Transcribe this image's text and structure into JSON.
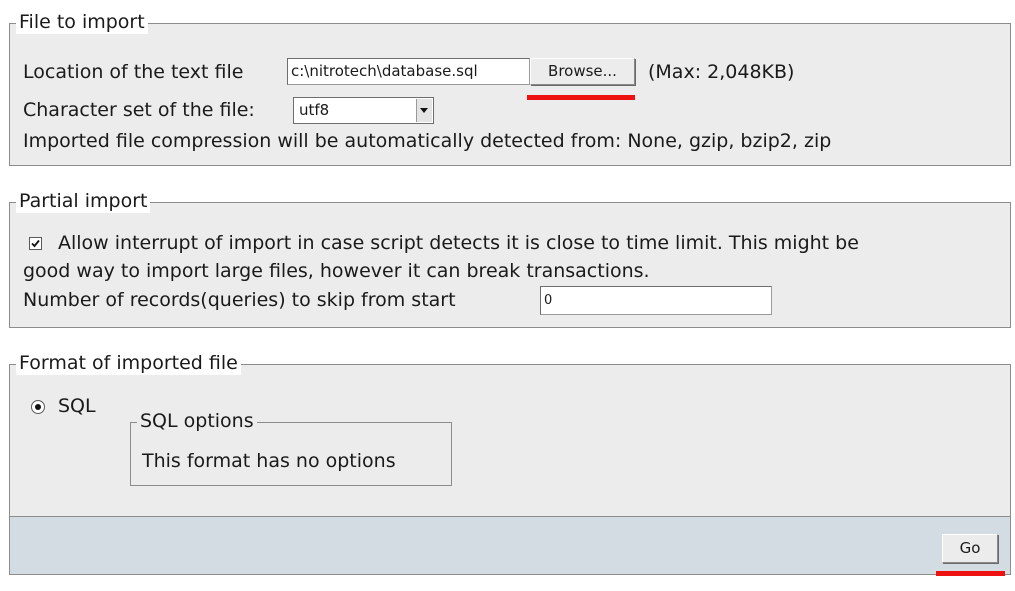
{
  "file_to_import": {
    "legend": "File to import",
    "location_label": "Location of the text file",
    "location_value": "c:\\nitrotech\\database.sql",
    "browse_label": "Browse...",
    "max_size": "(Max: 2,048KB)",
    "charset_label": "Character set of the file:",
    "charset_value": "utf8",
    "compression_note": "Imported file compression will be automatically detected from: None, gzip, bzip2, zip"
  },
  "partial_import": {
    "legend": "Partial import",
    "allow_interrupt_checked": true,
    "allow_interrupt_line1": "Allow interrupt of import in case script detects it is close to time limit. This might be",
    "allow_interrupt_line2": "good way to import large files, however it can break transactions.",
    "skip_label": "Number of records(queries) to skip from start",
    "skip_value": "0"
  },
  "format": {
    "legend": "Format of imported file",
    "sql_selected": true,
    "sql_label": "SQL",
    "options_legend": "SQL options",
    "options_note": "This format has no options"
  },
  "footer": {
    "go_label": "Go"
  },
  "colors": {
    "panel_bg": "#ececec",
    "footer_bg": "#d3dce3",
    "highlight_underline": "#ee1111"
  }
}
